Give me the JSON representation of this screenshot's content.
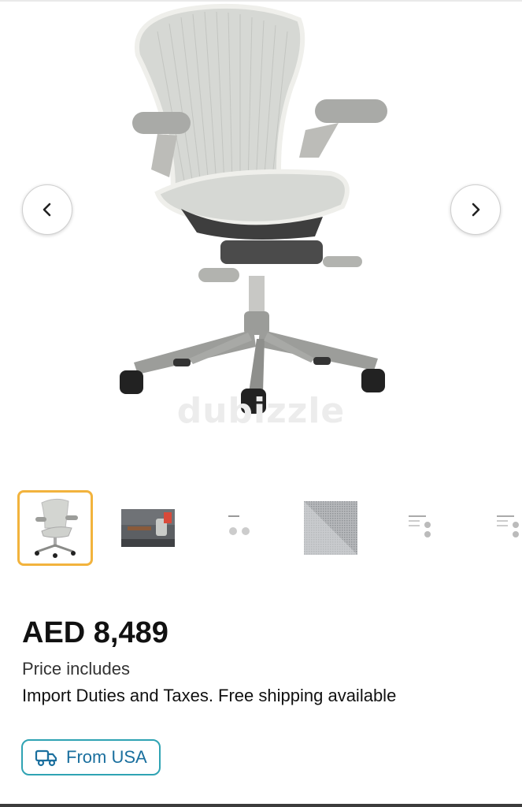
{
  "gallery": {
    "watermark": "dubizzle",
    "prev_icon": "chevron-left-icon",
    "next_icon": "chevron-right-icon",
    "thumbnails": [
      {
        "name": "chair-photo",
        "selected": true
      },
      {
        "name": "chair-in-room-photo",
        "selected": false
      },
      {
        "name": "spec-sheet-1",
        "selected": false
      },
      {
        "name": "mesh-swatch",
        "selected": false
      },
      {
        "name": "spec-sheet-2",
        "selected": false
      },
      {
        "name": "spec-sheet-3",
        "selected": false
      }
    ],
    "selected_color": "#f2b33d"
  },
  "listing": {
    "price": "AED 8,489",
    "price_note_line1": "Price includes",
    "price_note_line2": "Import Duties and Taxes. Free shipping available",
    "origin_badge": {
      "label": "From USA",
      "icon": "truck-icon",
      "color": "#2fa3b3"
    }
  }
}
